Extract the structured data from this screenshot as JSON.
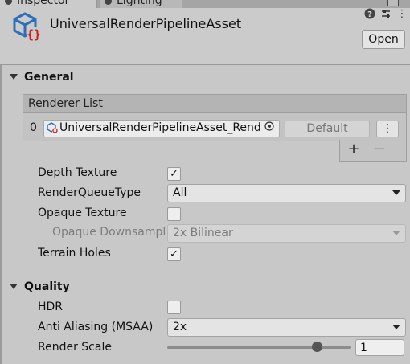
{
  "tabs": [
    {
      "label": "Inspector"
    },
    {
      "label": "Lighting"
    }
  ],
  "header": {
    "asset_title": "UniversalRenderPipelineAsset",
    "open_label": "Open",
    "icons": [
      "help-icon",
      "preset-icon",
      "settings-icon"
    ]
  },
  "general": {
    "title": "General",
    "renderer_list": {
      "header": "Renderer List",
      "items": [
        {
          "index": "0",
          "value": "UniversalRenderPipelineAsset_Renderer",
          "badge": "Default"
        }
      ],
      "more_label": "⋮",
      "plus_label": "+",
      "minus_label": "−"
    },
    "depth_texture": {
      "label": "Depth Texture",
      "checked": true
    },
    "render_queue_type": {
      "label": "RenderQueueType",
      "value": "All"
    },
    "opaque_texture": {
      "label": "Opaque Texture",
      "checked": false
    },
    "opaque_downsampling": {
      "label": "Opaque Downsampling",
      "value": "2x Bilinear",
      "enabled": false
    },
    "terrain_holes": {
      "label": "Terrain Holes",
      "checked": true
    }
  },
  "quality": {
    "title": "Quality",
    "hdr": {
      "label": "HDR",
      "checked": false
    },
    "anti_aliasing": {
      "label": "Anti Aliasing (MSAA)",
      "value": "2x"
    },
    "render_scale": {
      "label": "Render Scale",
      "value": "1",
      "slider_fraction": 0.82
    }
  },
  "glyphs": {
    "check": "✓"
  },
  "colors": {
    "asset_icon_blue": "#2a6fb8",
    "asset_icon_red": "#d11b1b"
  }
}
